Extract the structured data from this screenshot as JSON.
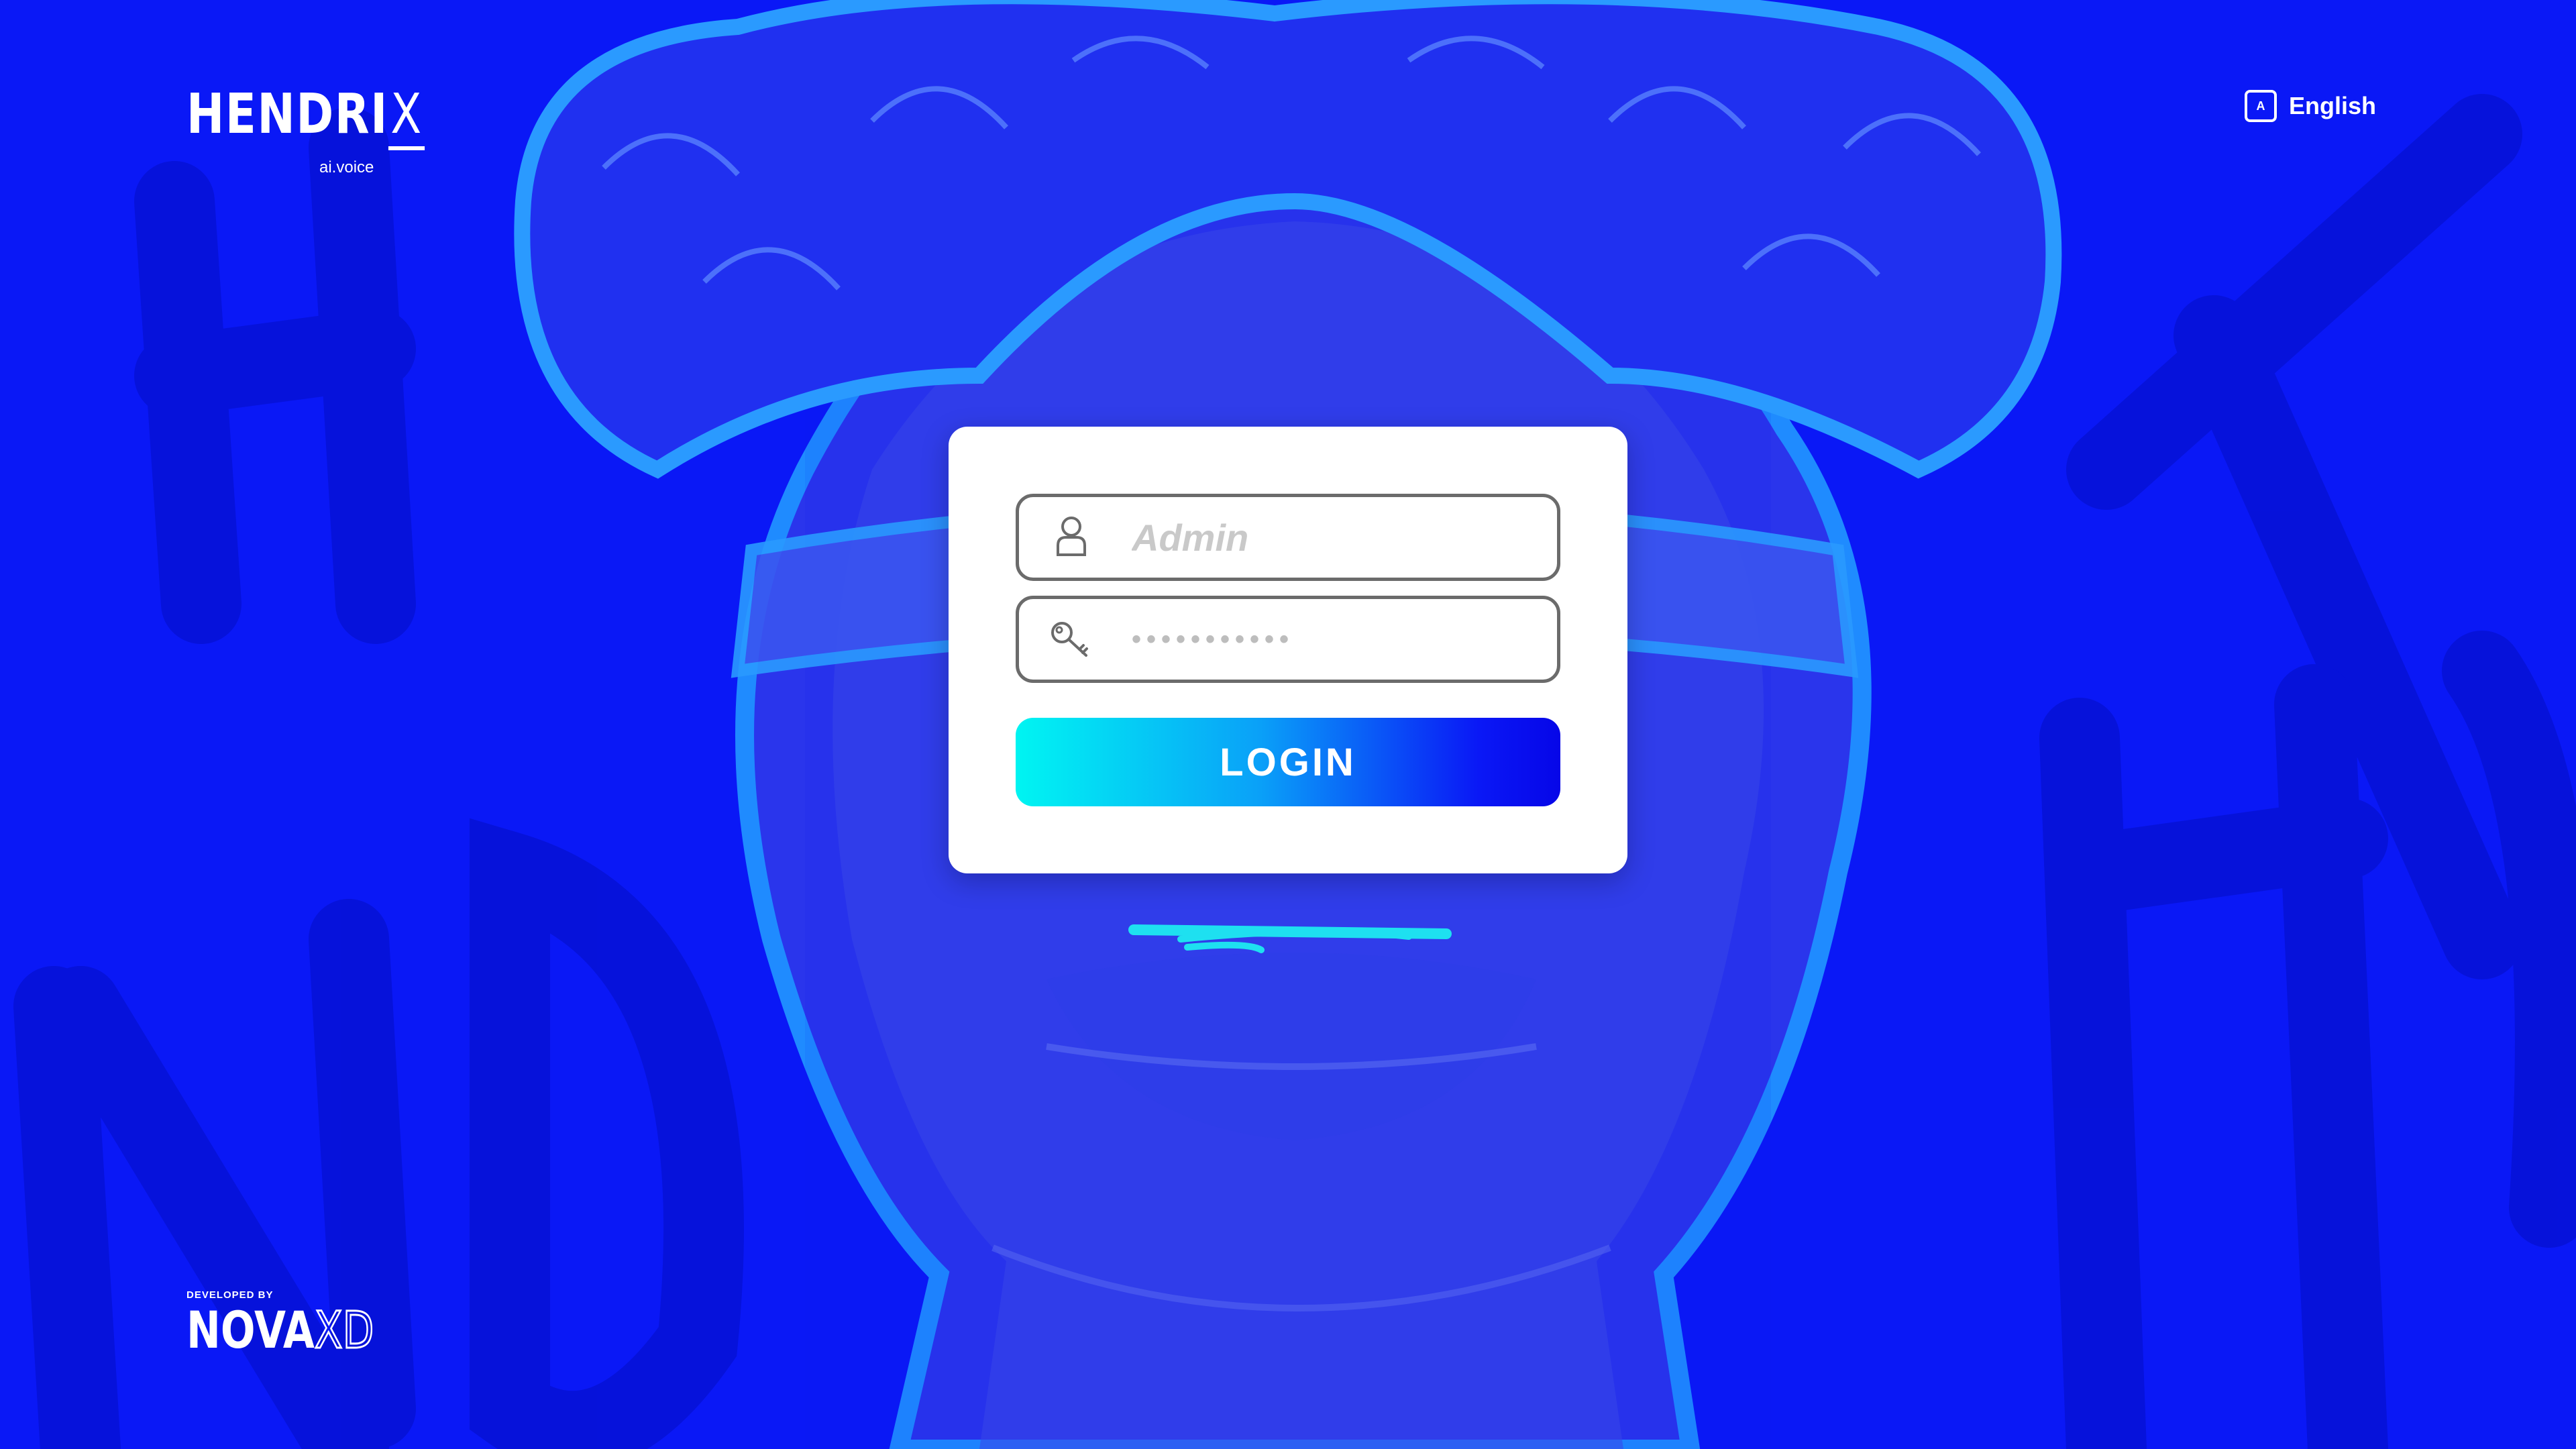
{
  "brand": {
    "name_main": "HENDRI",
    "name_x": "X",
    "subtitle": "ai.voice"
  },
  "language": {
    "icon_letter": "A",
    "label": "English"
  },
  "login_form": {
    "username_placeholder": "Admin",
    "password_placeholder": "•••••••••••",
    "submit_label": "LOGIN"
  },
  "footer": {
    "developed_by": "DEVELOPED BY",
    "company_main": "NOVA",
    "company_suffix": "XD"
  },
  "icons": {
    "username": "user-icon",
    "password": "key-icon",
    "language": "language-icon"
  },
  "colors": {
    "background": "#0a18f6",
    "card": "#ffffff",
    "button_gradient_start": "#00f5f2",
    "button_gradient_end": "#0606e8",
    "accent_cyan": "#1ee0f0"
  }
}
